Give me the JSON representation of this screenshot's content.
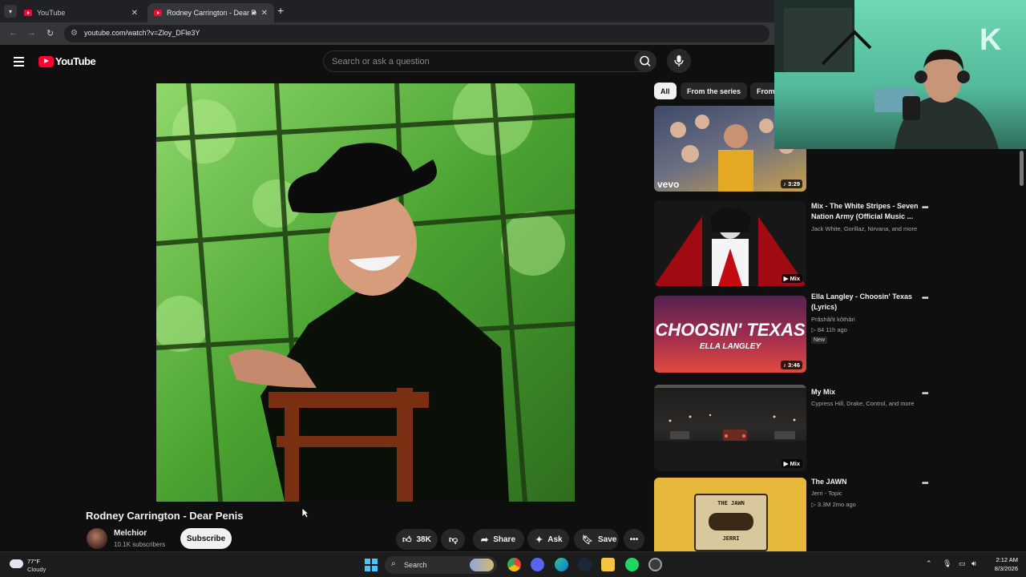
{
  "browser": {
    "tabs": [
      {
        "title": "YouTube",
        "active": false
      },
      {
        "title": "Rodney Carrington - Dear P",
        "active": true
      }
    ],
    "url": "youtube.com/watch?v=Zloy_DFle3Y"
  },
  "header": {
    "logo_text": "YouTube",
    "search_placeholder": "Search or ask a question"
  },
  "video": {
    "title": "Rodney Carrington - Dear Penis",
    "channel": "Melchior",
    "subscribers": "10.1K subscribers",
    "subscribe_label": "Subscribe",
    "likes": "38K",
    "share_label": "Share",
    "ask_label": "Ask",
    "save_label": "Save"
  },
  "chips": [
    "All",
    "From the series",
    "From"
  ],
  "recommendations": [
    {
      "duration": "3:29",
      "brand": "vevo",
      "title": "",
      "meta1": "",
      "meta2": ""
    },
    {
      "duration": "Mix",
      "title": "Mix - The White Stripes - Seven Nation Army (Official Music ...",
      "meta1": "Jack White, Gorillaz, Nirvana, and more",
      "meta2": ""
    },
    {
      "duration": "3:46",
      "title": "Ella Langley - Choosin' Texas (Lyrics)",
      "meta1": "Prâshâñt kõthâri",
      "meta2": "▷ 84   11h ago",
      "badge": "New",
      "thumb_text_1": "CHOOSIN' TEXAS",
      "thumb_text_2": "ELLA LANGLEY"
    },
    {
      "duration": "Mix",
      "title": "My Mix",
      "meta1": "Cypress Hill, Drake, Control, and more",
      "meta2": ""
    },
    {
      "duration": "",
      "title": "The JAWN",
      "meta1": "Jerri - Topic",
      "meta2": "▷ 3.3M   2mo ago",
      "thumb_text_1": "THE JAWN",
      "thumb_text_2": "JERRI"
    }
  ],
  "taskbar": {
    "temperature": "77°F",
    "condition": "Cloudy",
    "search_label": "Search",
    "time": "2:12 AM",
    "date": "8/3/2026"
  },
  "colors": {
    "accent": "#ff0033",
    "background": "#0f0f0f",
    "windows_blue": "#4cc2ff"
  }
}
